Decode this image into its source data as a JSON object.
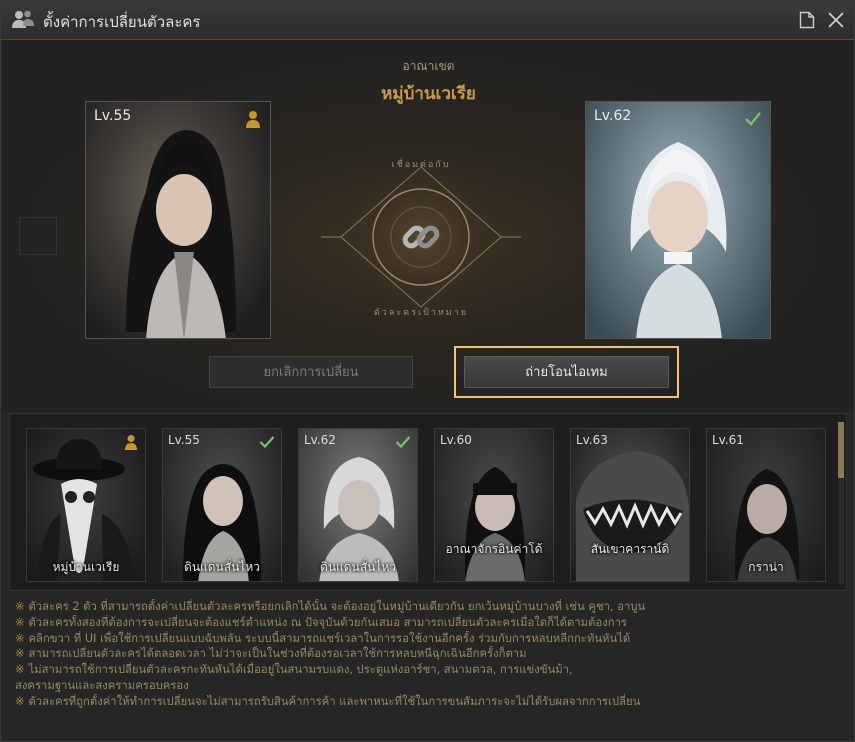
{
  "window": {
    "title": "ตั้งค่าการเปลี่ยนตัวละคร",
    "title_icon": "people-icon",
    "doc_icon": "document-icon",
    "close_icon": "close-icon"
  },
  "region": {
    "label": "อาณาเขต",
    "name": "หมู่บ้านเวเรีย"
  },
  "left_character": {
    "level": "Lv.55",
    "badge": "person-icon",
    "badge_color": "#c8962e"
  },
  "right_character": {
    "level": "Lv.62",
    "badge": "check-icon",
    "badge_color": "#7ac26a"
  },
  "link_emblem": {
    "icon": "chain-link-icon",
    "top_text": "เชื่อมต่อกับ",
    "bottom_text": "ตัวละครเป้าหมาย"
  },
  "buttons": {
    "cancel": "ยกเลิกการเปลี่ยน",
    "transfer": "ถ่ายโอนไอเทม",
    "highlight_color": "#f3c27a"
  },
  "characters": [
    {
      "level": "",
      "badge": "person-icon",
      "name": "หมู่บ้านเวเรีย"
    },
    {
      "level": "Lv.55",
      "badge": "check-icon",
      "name": "ดินแดนสั่นไหว"
    },
    {
      "level": "Lv.62",
      "badge": "check-icon",
      "name": "ดินแดนสั่นไหว"
    },
    {
      "level": "Lv.60",
      "badge": "",
      "name": "อาณาจักรอินค่าโด้"
    },
    {
      "level": "Lv.63",
      "badge": "",
      "name": "สันเขาคาราน์ดิ"
    },
    {
      "level": "Lv.61",
      "badge": "",
      "name": "กราน่า"
    }
  ],
  "notes": [
    "ตัวละคร 2 ตัว ที่สามารถตั้งค่าเปลี่ยนตัวละครหรือยกเลิกได้นั้น จะต้องอยู่ในหมู่บ้านเดียวกัน ยกเว้นหมู่บ้านบางที่ เช่น คูชา, อาบูน",
    "ตัวละครทั้งสองที่ต้องการจะเปลี่ยนจะต้องแชร์ตำแหน่ง ณ ปัจจุบันด้วยกันเสมอ สามารถเปลี่ยนตัวละครเมื่อใดก็ได้ตามต้องการ",
    "คลิกขวา ที่ UI เพื่อใช้การเปลี่ยนแบบฉับพลัน ระบบนี้สามารถแชร์เวลาในการรอใช้งานอีกครั้ง ร่วมกับการหลบหลีกกะทันหันได้",
    "สามารถเปลี่ยนตัวละครได้ตลอดเวลา ไม่ว่าจะเป็นในช่วงที่ต้องรอเวลาใช้การหลบหนีฉุกเฉินอีกครั้งก็ตาม",
    "ไม่สามารถใช้การเปลี่ยนตัวละครกะทันหันได้เมื่ออยู่ในสนามรบแดง, ประตูแห่งอาร์ชา, สนามตวล, การแข่งขันม้า,",
    "สงครามฐานและสงครามครอบครอง",
    "ตัวละครที่ถูกตั้งค่าให้ทำการเปลี่ยนจะไม่สามารถรับสินค้าการค้า และพาหนะที่ใช้ในการขนสัมภาระจะไม่ได้รับผลจากการเปลี่ยน"
  ],
  "note_marker": "※",
  "colors": {
    "accent_gold": "#c89a4a",
    "note_text": "#9a8a62"
  }
}
